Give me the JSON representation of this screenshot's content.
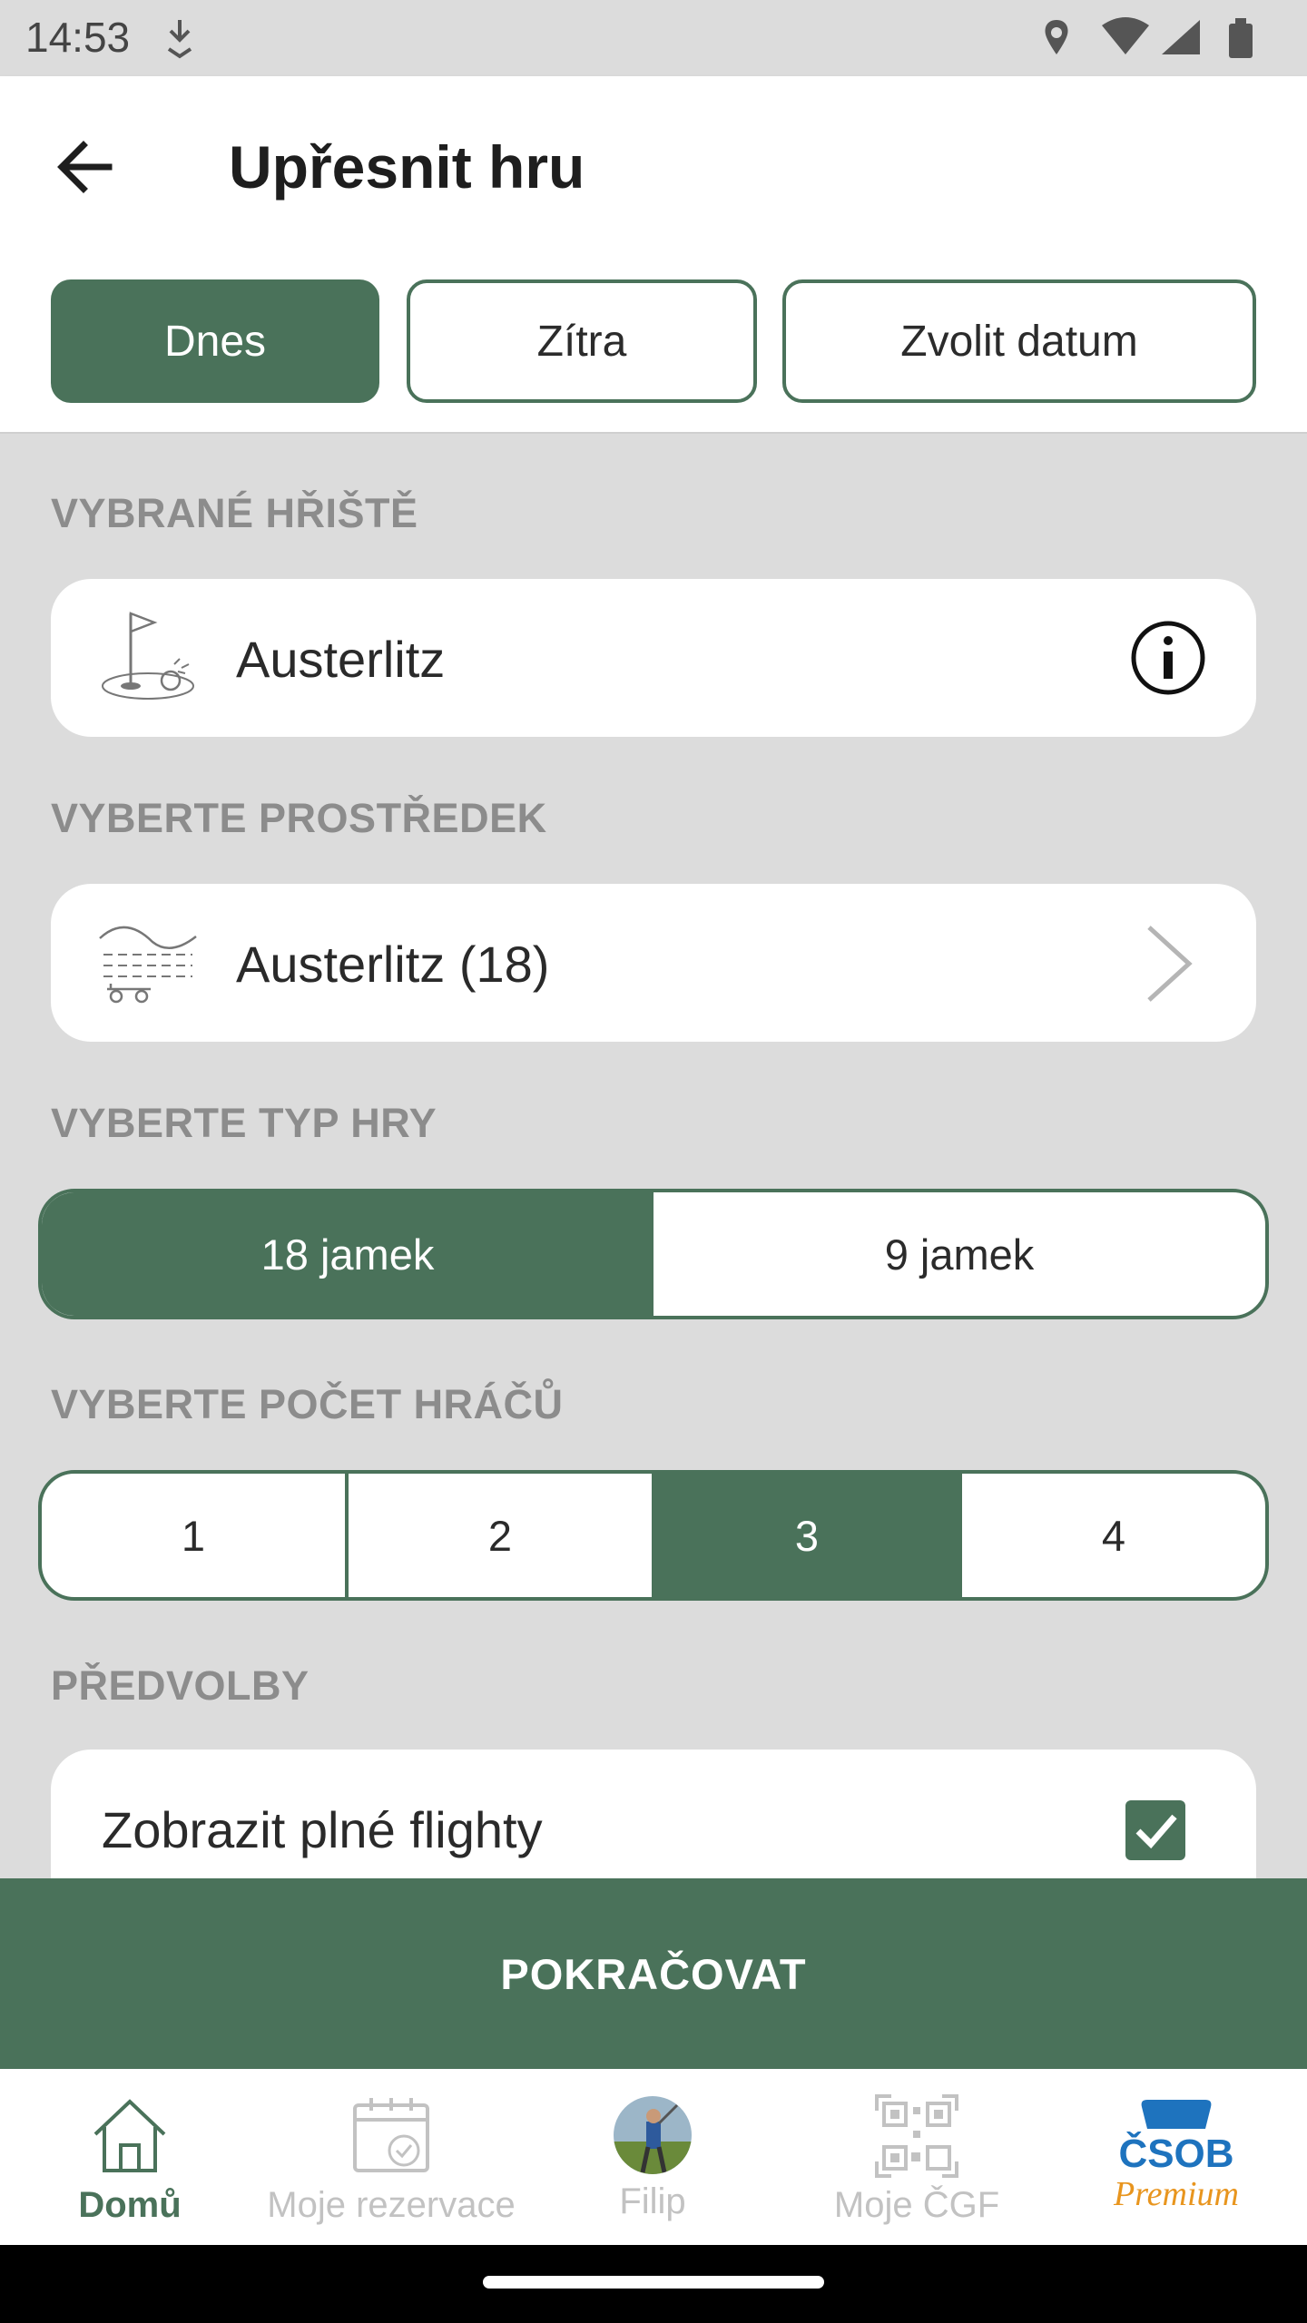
{
  "status_bar": {
    "time": "14:53"
  },
  "app_bar": {
    "title": "Upřesnit hru",
    "back_icon": "arrow-left-icon"
  },
  "date_options": [
    {
      "label": "Dnes",
      "selected": true
    },
    {
      "label": "Zítra",
      "selected": false
    },
    {
      "label": "Zvolit datum",
      "selected": false
    }
  ],
  "course_section": {
    "label": "VYBRANÉ HŘIŠTĚ",
    "value": "Austerlitz",
    "icon": "golf-flag-hole-icon",
    "action_icon": "info-icon"
  },
  "resource_section": {
    "label": "VYBERTE PROSTŘEDEK",
    "value": "Austerlitz (18)",
    "icon": "golf-course-icon",
    "action_icon": "chevron-right-icon"
  },
  "game_type_section": {
    "label": "VYBERTE TYP HRY",
    "options": [
      {
        "label": "18 jamek",
        "selected": true
      },
      {
        "label": "9 jamek",
        "selected": false
      }
    ]
  },
  "players_section": {
    "label": "VYBERTE POČET HRÁČŮ",
    "options": [
      {
        "label": "1",
        "selected": false
      },
      {
        "label": "2",
        "selected": false
      },
      {
        "label": "3",
        "selected": true
      },
      {
        "label": "4",
        "selected": false
      }
    ]
  },
  "preferences_section": {
    "label": "PŘEDVOLBY",
    "items": [
      {
        "label": "Zobrazit plné flighty",
        "checked": true
      }
    ]
  },
  "continue_button": {
    "label": "POKRAČOVAT"
  },
  "bottom_nav": {
    "items": [
      {
        "label": "Domů",
        "icon": "home-icon",
        "active": true
      },
      {
        "label": "Moje rezervace",
        "icon": "calendar-check-icon",
        "active": false
      },
      {
        "label": "Filip",
        "icon": "avatar",
        "active": false
      },
      {
        "label": "Moje ČGF",
        "icon": "qr-code-icon",
        "active": false
      },
      {
        "label": "",
        "icon": "csob-premium-logo",
        "logo_text": "ČSOB",
        "logo_script": "Premium",
        "active": false
      }
    ]
  },
  "colors": {
    "accent": "#4a725a",
    "background": "#dcdcdc",
    "section_label": "#8c8c8c",
    "csob_blue": "#1e73be",
    "csob_script": "#e8951e"
  }
}
